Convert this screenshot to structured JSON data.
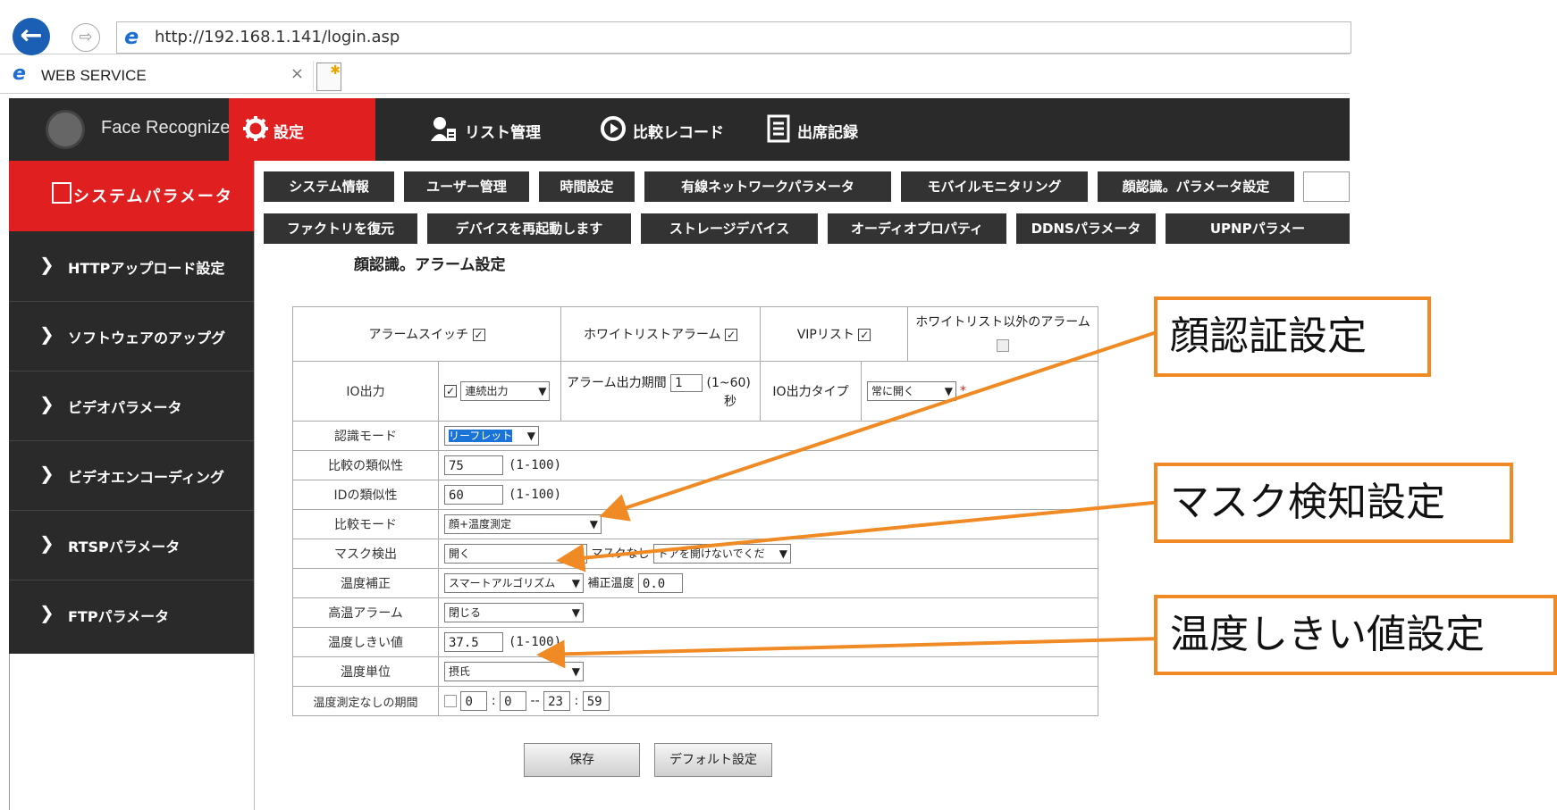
{
  "browser": {
    "url": "http://192.168.1.141/login.asp",
    "tab_title": "WEB SERVICE",
    "tab_close": "×"
  },
  "header": {
    "brand": "Face Recognize",
    "nav": [
      {
        "label": "設定",
        "icon": "gear-icon",
        "active": true
      },
      {
        "label": "リスト管理",
        "icon": "user-list-icon",
        "active": false
      },
      {
        "label": "比較レコード",
        "icon": "compare-record-icon",
        "active": false
      },
      {
        "label": "出席記録",
        "icon": "attendance-icon",
        "active": false
      }
    ]
  },
  "sidebar": {
    "active": "システムパラメータ",
    "items": [
      "HTTPアップロード設定",
      "ソフトウェアのアップグ",
      "ビデオパラメータ",
      "ビデオエンコーディング",
      "RTSPパラメータ",
      "FTPパラメータ"
    ]
  },
  "subtabs": {
    "row1": [
      "システム情報",
      "ユーザー管理",
      "時間設定",
      "有線ネットワークパラメータ",
      "モバイルモニタリング",
      "顔認識。パラメータ設定"
    ],
    "row2": [
      "ファクトリを復元",
      "デバイスを再起動します",
      "ストレージデバイス",
      "オーディオプロパティ",
      "DDNSパラメータ",
      "UPNPパラメー"
    ]
  },
  "section_title": "顔認識。アラーム設定",
  "form": {
    "alarm_switch": "アラームスイッチ",
    "whitelist_alarm": "ホワイトリストアラーム",
    "vip_list": "VIPリスト",
    "non_whitelist_alarm": "ホワイトリスト以外のアラーム",
    "io_output": "IO出力",
    "io_mode": "連続出力",
    "alarm_period_label": "アラーム出力期間",
    "alarm_period_value": "1",
    "alarm_period_range": "(1~60)",
    "alarm_period_unit": "秒",
    "io_type_label": "IO出力タイプ",
    "io_type_value": "常に開く",
    "recog_mode_label": "認識モード",
    "recog_mode_value": "リーフレット",
    "compare_sim_label": "比較の類似性",
    "compare_sim_value": "75",
    "compare_sim_range": "(1-100)",
    "id_sim_label": "IDの類似性",
    "id_sim_value": "60",
    "id_sim_range": "(1-100)",
    "compare_mode_label": "比較モード",
    "compare_mode_value": "顔+温度測定",
    "mask_label": "マスク検出",
    "mask_value": "開く",
    "no_mask_label": "マスクなし",
    "no_mask_value": "ドアを開けないでくだ",
    "temp_comp_label": "温度補正",
    "temp_comp_value": "スマートアルゴリズム",
    "comp_temp_label": "補正温度",
    "comp_temp_value": "0.0",
    "high_temp_label": "高温アラーム",
    "high_temp_value": "閉じる",
    "temp_threshold_label": "温度しきい値",
    "temp_threshold_value": "37.5",
    "temp_threshold_range": "(1-100)",
    "temp_unit_label": "温度単位",
    "temp_unit_value": "摂氏",
    "no_measure_label": "温度測定なしの期間",
    "no_measure_start_h": "0",
    "no_measure_start_m": "0",
    "no_measure_end_h": "23",
    "no_measure_end_m": "59",
    "colon": ":",
    "dash": "--",
    "checked_mark": "✓"
  },
  "buttons": {
    "save": "保存",
    "default": "デフォルト設定"
  },
  "callouts": {
    "face": "顔認証設定",
    "mask": "マスク検知設定",
    "threshold": "温度しきい値設定"
  },
  "colors": {
    "accent_red": "#e02020",
    "dark": "#2a2a2a",
    "callout_orange": "#f08a24"
  }
}
